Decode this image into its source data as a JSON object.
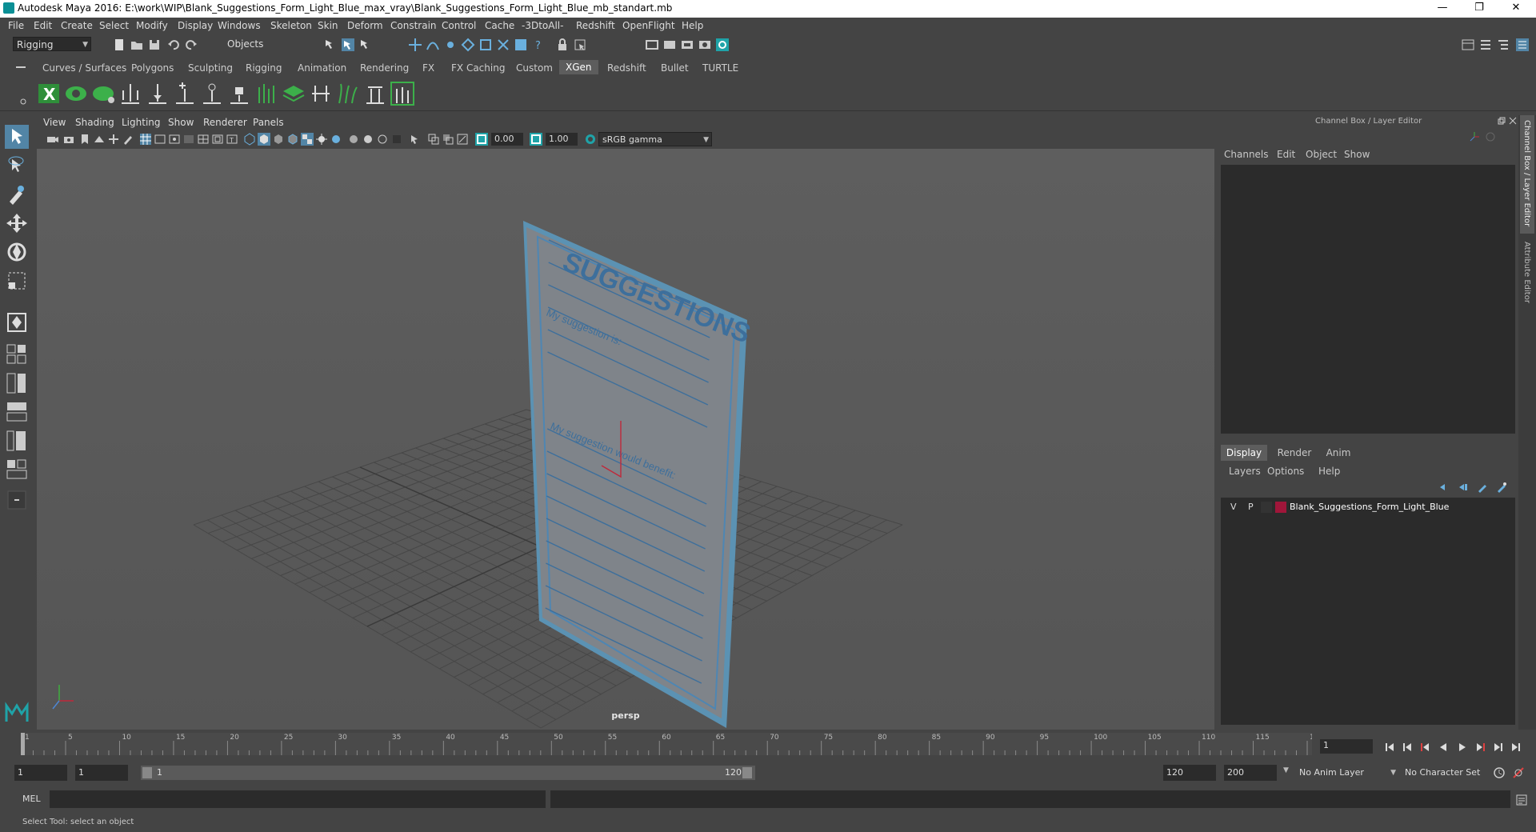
{
  "window": {
    "title": "Autodesk Maya 2016: E:\\work\\WIP\\Blank_Suggestions_Form_Light_Blue_max_vray\\Blank_Suggestions_Form_Light_Blue_mb_standart.mb",
    "minimize": "—",
    "maximize": "❐",
    "close": "✕"
  },
  "menubar": [
    "File",
    "Edit",
    "Create",
    "Select",
    "Modify",
    "Display",
    "Windows",
    "Skeleton",
    "Skin",
    "Deform",
    "Constrain",
    "Control",
    "Cache",
    "-3DtoAll-",
    "Redshift",
    "OpenFlight",
    "Help"
  ],
  "statusline": {
    "mode": "Rigging",
    "selection_mode": "Objects"
  },
  "shelf_tabs": [
    "Curves / Surfaces",
    "Polygons",
    "Sculpting",
    "Rigging",
    "Animation",
    "Rendering",
    "FX",
    "FX Caching",
    "Custom",
    "XGen",
    "Redshift",
    "Bullet",
    "TURTLE"
  ],
  "shelf_active": "XGen",
  "viewport": {
    "menu": [
      "View",
      "Shading",
      "Lighting",
      "Show",
      "Renderer",
      "Panels"
    ],
    "exposure": "0.00",
    "gamma": "1.00",
    "color_space": "sRGB gamma",
    "camera_label": "persp"
  },
  "model_text": {
    "heading": "SUGGESTIONS",
    "line1": "My suggestion is:",
    "line2": "My suggestion would benefit:"
  },
  "channel_box": {
    "title": "Channel Box / Layer Editor",
    "menu": [
      "Channels",
      "Edit",
      "Object",
      "Show"
    ]
  },
  "layer_editor": {
    "tabs": [
      "Display",
      "Render",
      "Anim"
    ],
    "active_tab": "Display",
    "menu": [
      "Layers",
      "Options",
      "Help"
    ],
    "layers": [
      {
        "v": "V",
        "p": "P",
        "name": "Blank_Suggestions_Form_Light_Blue",
        "color": "#a0163a"
      }
    ]
  },
  "side_tabs": {
    "channel_box": "Channel Box / Layer Editor",
    "attribute_editor": "Attribute Editor"
  },
  "timeline": {
    "ticks": [
      "1",
      "5",
      "10",
      "15",
      "20",
      "25",
      "30",
      "35",
      "40",
      "45",
      "50",
      "55",
      "60",
      "65",
      "70",
      "75",
      "80",
      "85",
      "90",
      "95",
      "100",
      "105",
      "110",
      "115",
      "120"
    ],
    "current_frame": "1"
  },
  "range": {
    "start": "1",
    "playback_start": "1",
    "slider_start": "1",
    "slider_end": "120",
    "playback_end": "120",
    "end": "200",
    "anim_layer": "No Anim Layer",
    "character_set": "No Character Set"
  },
  "command_line": {
    "label": "MEL"
  },
  "help_line": {
    "text": "Select Tool: select an object"
  },
  "colors": {
    "accent": "#5285a6",
    "layer_color": "#a0163a",
    "paper": "#7f848a",
    "ink": "#3d6f9c"
  }
}
